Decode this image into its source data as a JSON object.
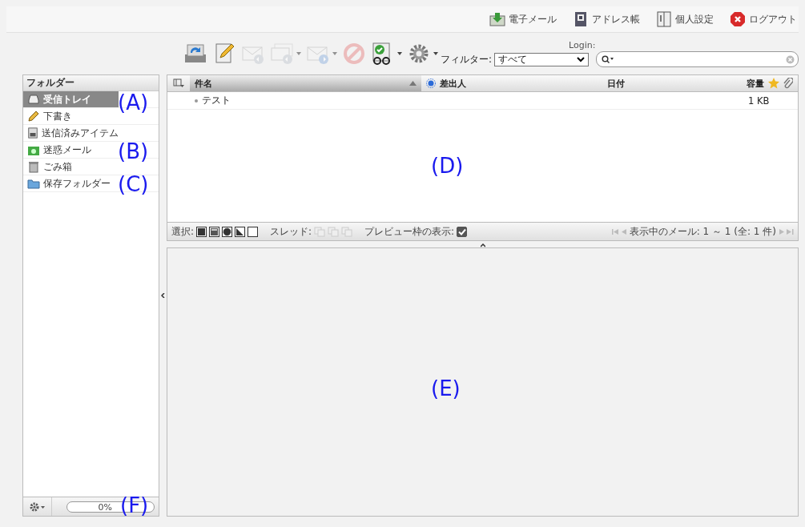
{
  "top_links": [
    {
      "label": "電子メール"
    },
    {
      "label": "アドレス帳"
    },
    {
      "label": "個人設定"
    },
    {
      "label": "ログアウト"
    }
  ],
  "toolbar": {
    "buttons": [
      {
        "disabled": false,
        "menu": false
      },
      {
        "disabled": false,
        "menu": false
      },
      {
        "disabled": true,
        "menu": false
      },
      {
        "disabled": true,
        "menu": true
      },
      {
        "disabled": true,
        "menu": true
      },
      {
        "disabled": true,
        "menu": false
      },
      {
        "disabled": false,
        "menu": true
      },
      {
        "disabled": false,
        "menu": true
      }
    ],
    "login_label": "Login:",
    "filter_label": "フィルター:",
    "filter_value": "すべて"
  },
  "folders": {
    "title": "フォルダー",
    "items": [
      {
        "label": "受信トレイ",
        "selected": true
      },
      {
        "label": "下書き",
        "selected": false
      },
      {
        "label": "送信済みアイテム",
        "selected": false
      },
      {
        "label": "迷惑メール",
        "selected": false
      },
      {
        "label": "ごみ箱",
        "selected": false
      },
      {
        "label": "保存フォルダー",
        "selected": false
      }
    ],
    "quota": "0%"
  },
  "message_list": {
    "columns": [
      "件名",
      "差出人",
      "日付",
      "容量"
    ],
    "rows": [
      {
        "subject": "テスト",
        "from": "",
        "date": "",
        "size": "1 KB"
      }
    ],
    "select_label": "選択:",
    "thread_label": "スレッド:",
    "preview_label": "プレビュー枠の表示:",
    "preview_checked": true,
    "count": "表示中のメール: 1 ～ 1 (全: 1 件)"
  },
  "annotations": [
    {
      "label": "(A)"
    },
    {
      "label": "(B)"
    },
    {
      "label": "(C)"
    },
    {
      "label": "(D)"
    },
    {
      "label": "(E)"
    },
    {
      "label": "(F)"
    }
  ]
}
